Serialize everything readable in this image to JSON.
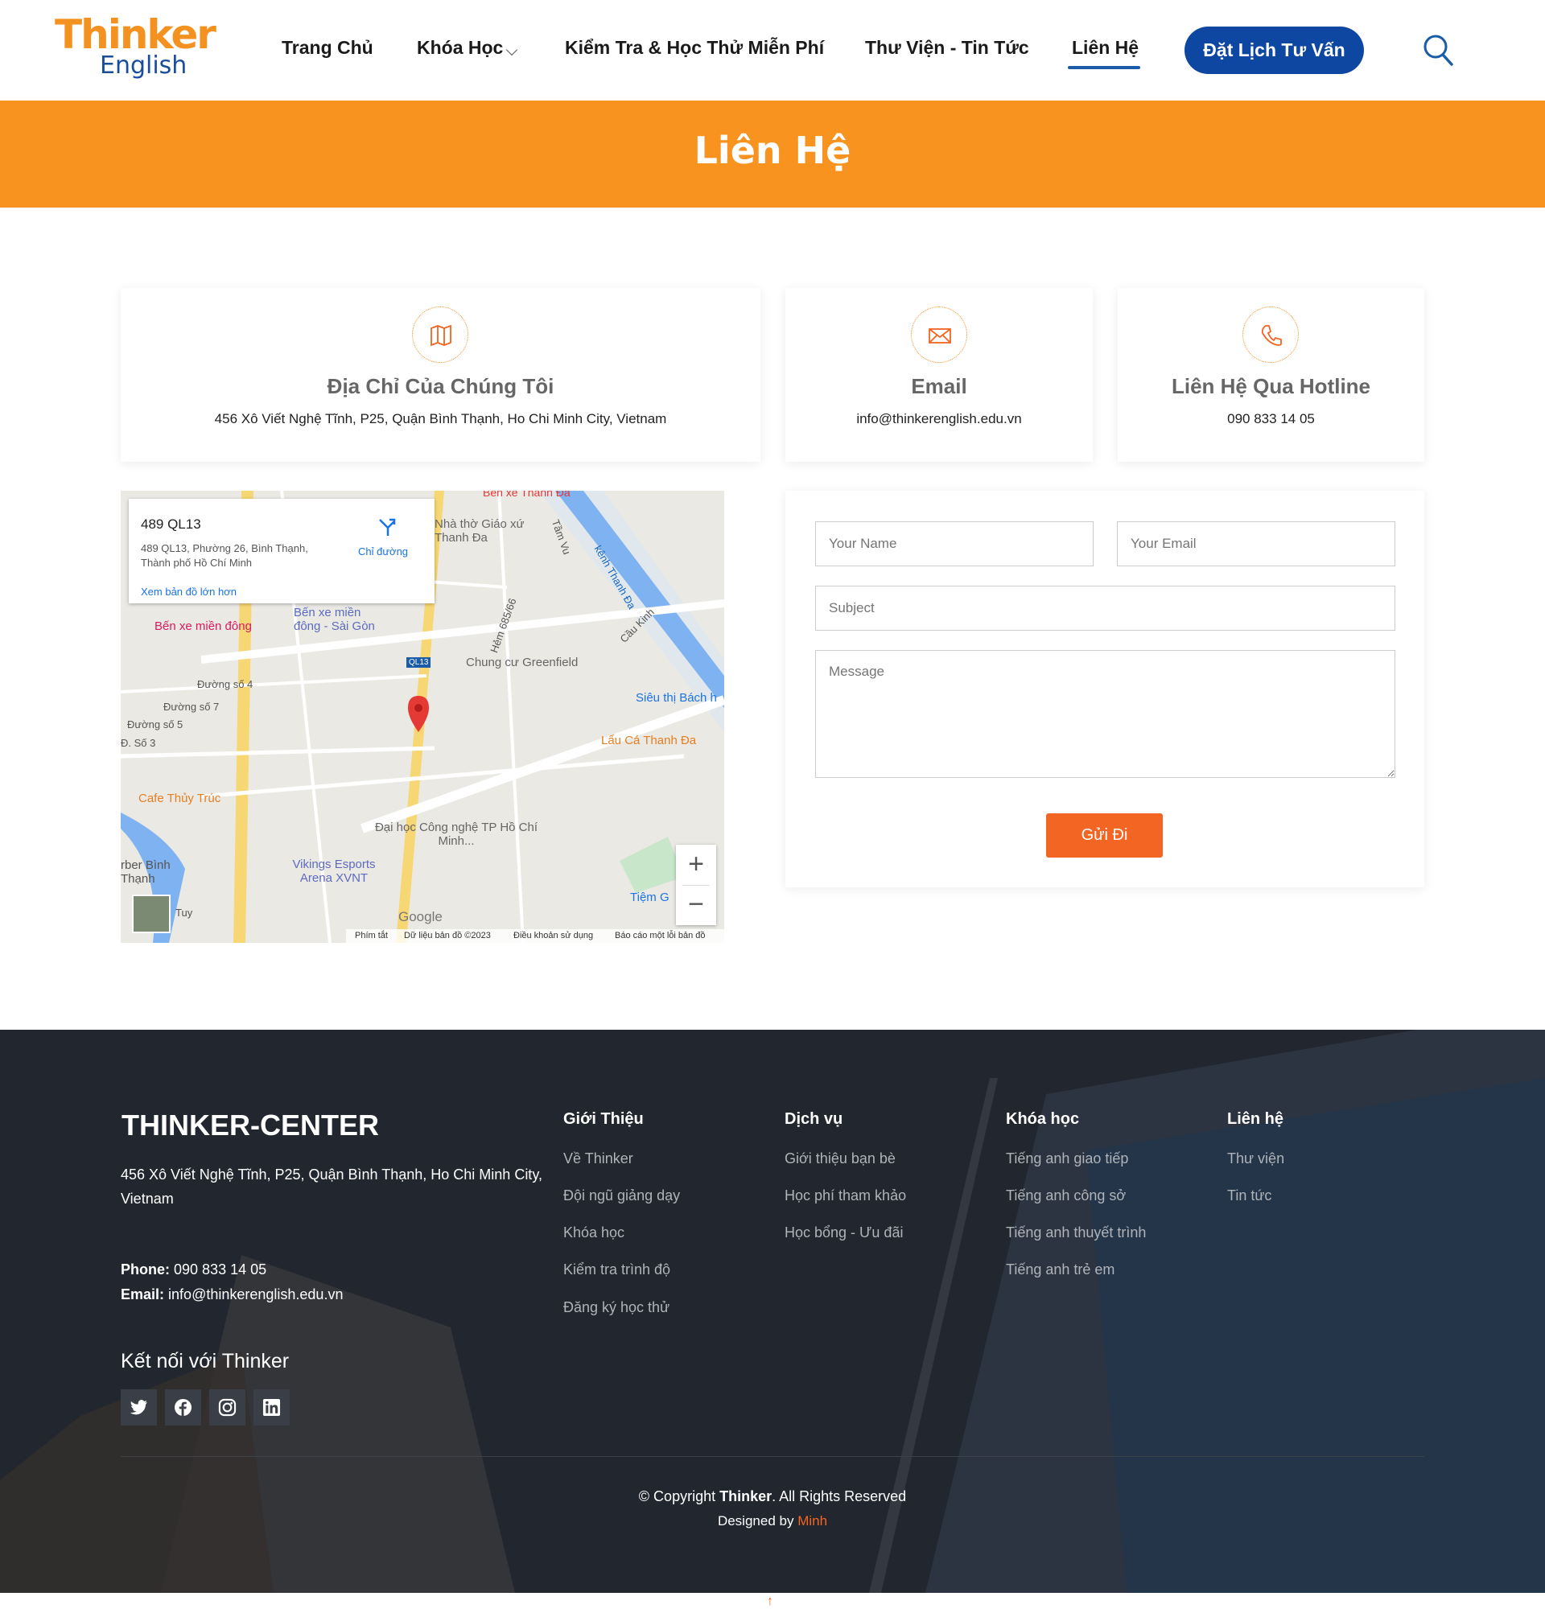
{
  "header": {
    "logo_text_1": "Thinker",
    "logo_text_2": "English",
    "nav": [
      "Trang Chủ",
      "Khóa Học",
      "Kiểm Tra & Học Thử Miễn Phí",
      "Thư Viện - Tin Tức",
      "Liên Hệ"
    ],
    "cta_label": "Đặt Lịch Tư Vấn"
  },
  "banner": {
    "title": "Liên Hệ"
  },
  "contact_cards": {
    "address": {
      "title": "Địa Chỉ Của Chúng Tôi",
      "value": "456 Xô Viết Nghệ Tĩnh, P25, Quận Bình Thạnh, Ho Chi Minh City, Vietnam"
    },
    "email": {
      "title": "Email",
      "value": "info@thinkerenglish.edu.vn"
    },
    "hotline": {
      "title": "Liên Hệ Qua Hotline",
      "value": "090 833 14 05"
    }
  },
  "map": {
    "place_title": "489 QL13",
    "place_address": "489 QL13, Phường 26, Bình Thạnh, Thành phố Hồ Chí Minh",
    "directions_label": "Chỉ đường",
    "larger_map_link": "Xem bản đồ lớn hơn",
    "labels": [
      "Bến xe miền đông",
      "Bến xe miền đông - Sài Gòn",
      "Nhà thờ Giáo xứ Thanh Đa",
      "Chung cư Greenfield",
      "Siêu thị Bách h",
      "Lẩu Cá Thanh Đa",
      "Cafe Thủy Trúc",
      "Đại học Công nghệ TP Hồ Chí Minh...",
      "Vikings Esports Arena XVNT",
      "Tiệm G",
      "Đường số 4",
      "Đường số 7",
      "Đường số 5",
      "Đ. Số 3",
      "Hẻm 685/66",
      "Tầm Vu",
      "kênh Thanh Đa",
      "Cầu Kinh",
      "QL13",
      "Bến xe Thanh Đa",
      "rber Bình Thạnh",
      "Tuy",
      "Google"
    ],
    "footer_links": [
      "Phím tắt",
      "Dữ liệu bản đồ ©2023",
      "Điều khoản sử dụng",
      "Báo cáo một lỗi bản đồ"
    ],
    "zoom_in": "+",
    "zoom_out": "−"
  },
  "form": {
    "name_placeholder": "Your Name",
    "email_placeholder": "Your Email",
    "subject_placeholder": "Subject",
    "message_placeholder": "Message",
    "submit_label": "Gửi Đi"
  },
  "footer": {
    "brand": "THINKER-CENTER",
    "address": "456 Xô Viết Nghệ Tĩnh, P25, Quận Bình Thạnh, Ho Chi Minh City, Vietnam",
    "phone_label": "Phone:",
    "phone": "090 833 14 05",
    "email_label": "Email:",
    "email": "info@thinkerenglish.edu.vn",
    "connect": "Kết nối với Thinker",
    "columns": [
      {
        "heading": "Giới Thiệu",
        "links": [
          "Về Thinker",
          "Đội ngũ giảng dạy",
          "Khóa học",
          "Kiểm tra trình độ",
          "Đăng ký học thử"
        ]
      },
      {
        "heading": "Dịch vụ",
        "links": [
          "Giới thiệu bạn bè",
          "Học phí tham khảo",
          "Học bổng - Ưu đãi"
        ]
      },
      {
        "heading": "Khóa học",
        "links": [
          "Tiếng anh giao tiếp",
          "Tiếng anh công sở",
          "Tiếng anh thuyết trình",
          "Tiếng anh trẻ em"
        ]
      },
      {
        "heading": "Liên hệ",
        "links": [
          "Thư viện",
          "Tin tức"
        ]
      }
    ],
    "copyright_prefix": "© Copyright ",
    "copyright_brand": "Thinker",
    "copyright_suffix": ". All Rights Reserved",
    "designed_by": "Designed by ",
    "designer": "Minh"
  },
  "back_to_top": "↑",
  "colors": {
    "orange": "#f7931e",
    "navy": "#0d47a1",
    "button_orange": "#f26522",
    "footer_bg": "#22262e"
  }
}
